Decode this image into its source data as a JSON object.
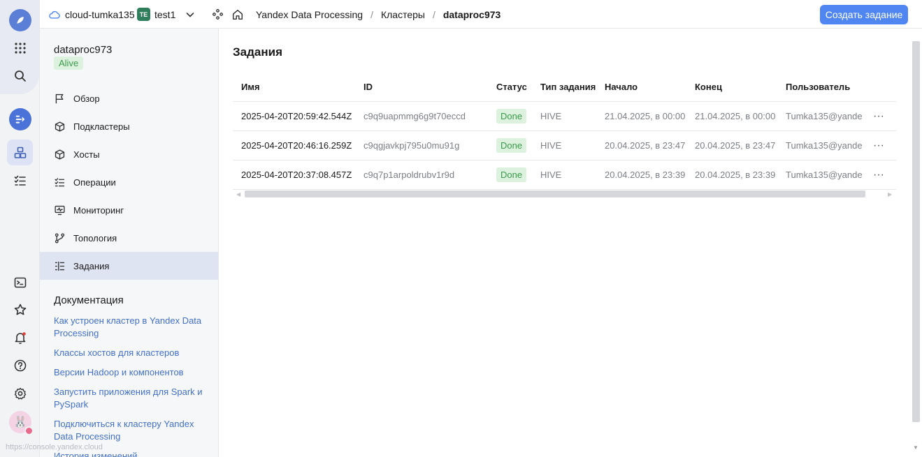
{
  "topbar": {
    "cloud_name": "cloud-tumka135",
    "folder_badge": "TE",
    "folder_name": "test1",
    "breadcrumbs": [
      "Yandex Data Processing",
      "Кластеры",
      "dataproc973"
    ],
    "separator": "/",
    "create_button": "Создать задание"
  },
  "sidebar": {
    "cluster_name": "dataproc973",
    "status": "Alive",
    "items": [
      {
        "label": "Обзор",
        "icon": "flag-icon"
      },
      {
        "label": "Подкластеры",
        "icon": "cube-icon"
      },
      {
        "label": "Хосты",
        "icon": "cube-icon"
      },
      {
        "label": "Операции",
        "icon": "list-check-icon"
      },
      {
        "label": "Мониторинг",
        "icon": "monitor-icon"
      },
      {
        "label": "Топология",
        "icon": "topology-icon"
      },
      {
        "label": "Задания",
        "icon": "list-icon"
      }
    ],
    "active_item": "Задания",
    "docs_title": "Документация",
    "docs": [
      "Как устроен кластер в Yandex Data Processing",
      "Классы хостов для кластеров",
      "Версии Hadoop и компонентов",
      "Запустить приложения для Spark и PySpark",
      "Подключиться к кластеру Yandex Data Processing",
      "История изменений"
    ],
    "status_url": "https://console.yandex.cloud"
  },
  "main": {
    "title": "Задания",
    "columns": [
      "Имя",
      "ID",
      "Статус",
      "Тип задания",
      "Начало",
      "Конец",
      "Пользователь"
    ],
    "rows": [
      {
        "name": "2025-04-20T20:59:42.544Z",
        "id": "c9q9uapmmg6g9t70eccd",
        "status": "Done",
        "type": "HIVE",
        "start": "21.04.2025, в 00:00",
        "end": "21.04.2025, в 00:00",
        "user": "Tumka135@yande"
      },
      {
        "name": "2025-04-20T20:46:16.259Z",
        "id": "c9qgjavkpj795u0mu91g",
        "status": "Done",
        "type": "HIVE",
        "start": "20.04.2025, в 23:47",
        "end": "20.04.2025, в 23:47",
        "user": "Tumka135@yande"
      },
      {
        "name": "2025-04-20T20:37:08.457Z",
        "id": "c9q7p1arpoldrubv1r9d",
        "status": "Done",
        "type": "HIVE",
        "start": "20.04.2025, в 23:39",
        "end": "20.04.2025, в 23:39",
        "user": "Tumka135@yande"
      }
    ],
    "row_menu": "···"
  },
  "colors": {
    "accent": "#4f86f1",
    "link": "#4270c9",
    "success_bg": "#dcf1de",
    "success_text": "#3a9a4a",
    "active_nav": "#dfe4f3"
  }
}
